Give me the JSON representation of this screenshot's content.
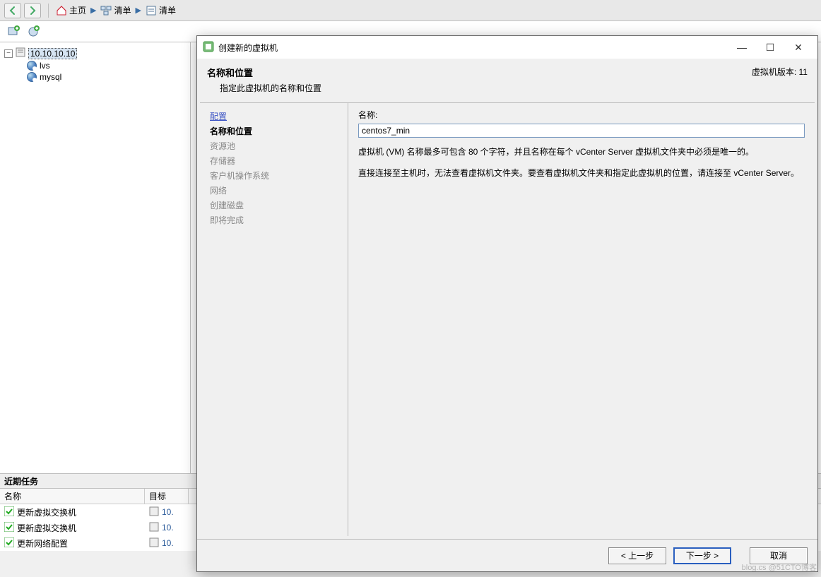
{
  "breadcrumb": {
    "home": "主页",
    "list1": "清单",
    "list2": "清单"
  },
  "tree": {
    "host": "10.10.10.10",
    "vm1": "lvs",
    "vm2": "mysql"
  },
  "recent": {
    "title": "近期任务",
    "col_name": "名称",
    "col_target": "目标",
    "rows": [
      {
        "name": "更新虚拟交换机",
        "target": "10."
      },
      {
        "name": "更新虚拟交换机",
        "target": "10."
      },
      {
        "name": "更新网络配置",
        "target": "10."
      }
    ]
  },
  "dialog": {
    "title": "创建新的虚拟机",
    "version_label": "虚拟机版本: 11",
    "header_title": "名称和位置",
    "header_sub": "指定此虚拟机的名称和位置",
    "steps": {
      "config": "配置",
      "name_loc": "名称和位置",
      "pool": "资源池",
      "storage": "存储器",
      "guest_os": "客户机操作系统",
      "network": "网络",
      "disk": "创建磁盘",
      "finish": "即将完成"
    },
    "form": {
      "name_label": "名称:",
      "name_value": "centos7_min",
      "hint1": "虚拟机 (VM) 名称最多可包含 80 个字符，并且名称在每个 vCenter Server 虚拟机文件夹中必须是唯一的。",
      "hint2": "直接连接至主机时，无法查看虚拟机文件夹。要查看虚拟机文件夹和指定此虚拟机的位置，请连接至 vCenter Server。"
    },
    "buttons": {
      "back": "< 上一步",
      "next": "下一步 >",
      "cancel": "取消"
    }
  },
  "watermark": "blog.cs @51CTO博客"
}
